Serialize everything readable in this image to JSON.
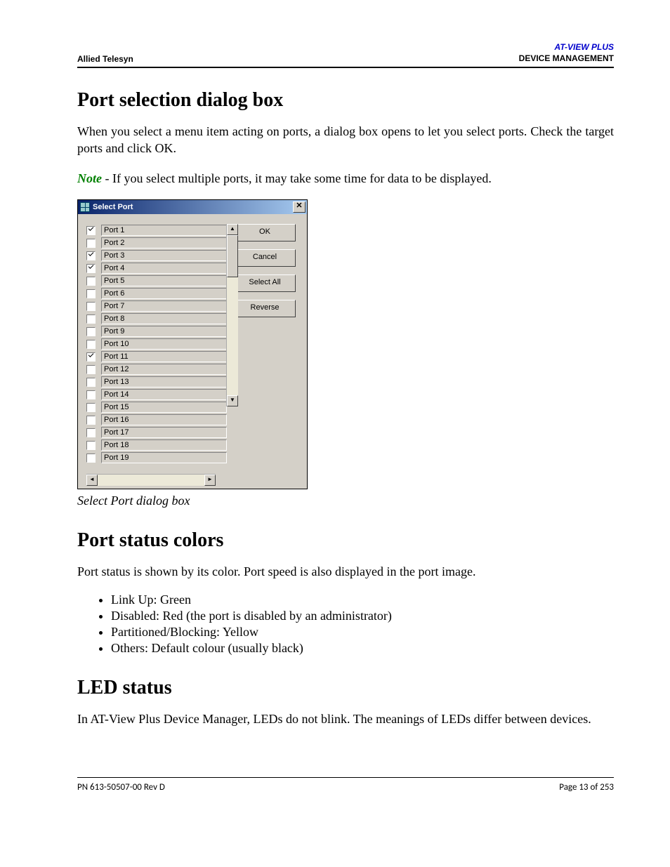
{
  "header": {
    "left": "Allied Telesyn",
    "right_line1": "AT-VIEW PLUS",
    "right_line2": "DEVICE MANAGEMENT"
  },
  "section1": {
    "title": "Port selection dialog box",
    "para1": "When you select a menu item acting on ports, a dialog box opens to let you select ports. Check the target ports and click OK.",
    "note_lead": "Note",
    "note_rest": " - If you select multiple ports, it may take some time for data to be displayed."
  },
  "dialog": {
    "title": "Select Port",
    "close_glyph": "✕",
    "buttons": {
      "ok": "OK",
      "cancel": "Cancel",
      "select_all": "Select All",
      "reverse": "Reverse"
    },
    "ports": [
      {
        "label": "Port 1",
        "checked": true
      },
      {
        "label": "Port 2",
        "checked": false
      },
      {
        "label": "Port 3",
        "checked": true
      },
      {
        "label": "Port 4",
        "checked": true
      },
      {
        "label": "Port 5",
        "checked": false
      },
      {
        "label": "Port 6",
        "checked": false
      },
      {
        "label": "Port 7",
        "checked": false
      },
      {
        "label": "Port 8",
        "checked": false
      },
      {
        "label": "Port 9",
        "checked": false
      },
      {
        "label": "Port 10",
        "checked": false
      },
      {
        "label": "Port 11",
        "checked": true
      },
      {
        "label": "Port 12",
        "checked": false
      },
      {
        "label": "Port 13",
        "checked": false
      },
      {
        "label": "Port 14",
        "checked": false
      },
      {
        "label": "Port 15",
        "checked": false
      },
      {
        "label": "Port 16",
        "checked": false
      },
      {
        "label": "Port 17",
        "checked": false
      },
      {
        "label": "Port 18",
        "checked": false
      },
      {
        "label": "Port 19",
        "checked": false
      }
    ],
    "scroll": {
      "up": "▲",
      "down": "▼",
      "left": "◄",
      "right": "►"
    }
  },
  "caption": "Select Port dialog box",
  "section2": {
    "title": "Port status colors",
    "intro": "Port status is shown by its color. Port speed is also displayed in the port image.",
    "items": [
      "Link Up: Green",
      "Disabled: Red (the port is disabled by an administrator)",
      "Partitioned/Blocking: Yellow",
      "Others: Default colour (usually black)"
    ]
  },
  "section3": {
    "title": "LED status",
    "para": "In AT-View Plus Device Manager, LEDs do not blink. The meanings of LEDs differ between devices."
  },
  "footer": {
    "left": "PN 613-50507-00 Rev D",
    "right": "Page 13 of 253"
  }
}
